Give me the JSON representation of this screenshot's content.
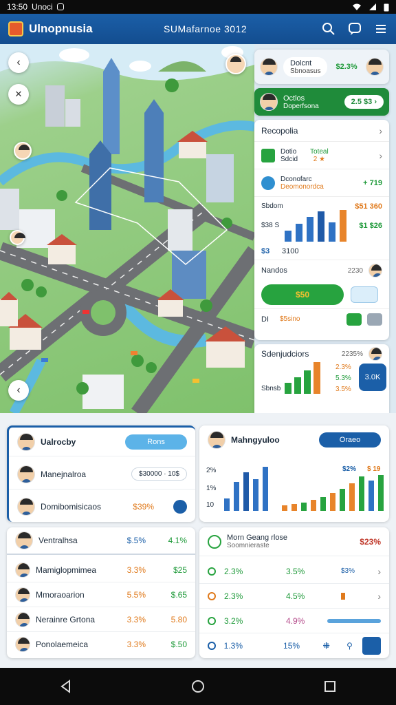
{
  "status": {
    "time": "13:50",
    "carrier": "Unoci"
  },
  "appbar": {
    "title": "Ulnopnusia",
    "center": "SUMafarnoe 3012"
  },
  "right_panel": {
    "profile": {
      "name": "Dolcnt",
      "sub": "Sbnoasus",
      "value": "$2.3%"
    },
    "green_card": {
      "name": "Octlos",
      "sub": "Doperfsona",
      "value": "2.5 $3"
    },
    "section_title": "Recopolia",
    "item1": {
      "name": "Dotio",
      "sub": "Sdcid",
      "v1": "Toteal",
      "v2": "2 ★"
    },
    "item2": {
      "name": "Dconofarc",
      "sub": "Deomonordca",
      "value": "+ 719"
    },
    "chart": {
      "label1": "Sbdom",
      "value1": "$51 360",
      "label2": "$38 S",
      "value2": "$1 $26",
      "caption_a": "$3",
      "caption_b": "3100"
    },
    "section2_title": "Nandos",
    "section2_value": "2230",
    "pill_label": "$50",
    "row3": {
      "label": "DI",
      "value": "$5sino"
    },
    "ranking": {
      "title": "Sdenjudciors",
      "value": "2235%",
      "pct1": "2.3%",
      "pct2": "5.3%",
      "pct3": "3.5%",
      "badge": "3.0K",
      "label": "Sbnsb"
    }
  },
  "card_left_top": {
    "title": "Ualrocby",
    "button": "Rons",
    "rows": [
      {
        "name": "Manejnalroa",
        "pill": "$30000 · 10$"
      },
      {
        "name": "Domibomisicaos",
        "value": "$39%"
      }
    ]
  },
  "card_right_top": {
    "title": "Mahngyuloo",
    "button": "Oraeo",
    "chart_labels": [
      "2%",
      "1%",
      "10"
    ],
    "chart_tags": [
      "$2%",
      "$ 19"
    ]
  },
  "card_left_bottom": {
    "header": {
      "name": "Ventralhsa",
      "v1": "$.5%",
      "v2": "4.1%"
    },
    "rows": [
      {
        "name": "Mamiglopmimea",
        "v1": "3.3%",
        "v2": "$25"
      },
      {
        "name": "Mmoraoarion",
        "v1": "5.5%",
        "v2": "$.65"
      },
      {
        "name": "Nerainre Grtona",
        "v1": "3.3%",
        "v2": "5.80"
      },
      {
        "name": "Ponolaemeica",
        "v1": "3.3%",
        "v2": "$.50"
      }
    ]
  },
  "card_right_bottom": {
    "header": {
      "name": "Morn",
      "sub": "Soomnieraste",
      "title2": "Geang rlose",
      "value": "$23%"
    },
    "rows": [
      {
        "v1": "2.3%",
        "v2": "3.5%",
        "v3": "$3%"
      },
      {
        "v1": "2.3%",
        "v2": "4.5%"
      },
      {
        "v1": "3.2%",
        "v2": "4.9%"
      },
      {
        "v1": "1.3%",
        "v2": "15%"
      }
    ]
  },
  "colors": {
    "brand": "#1b5fa8",
    "accent_green": "#27a33f",
    "accent_orange": "#e8842a"
  }
}
